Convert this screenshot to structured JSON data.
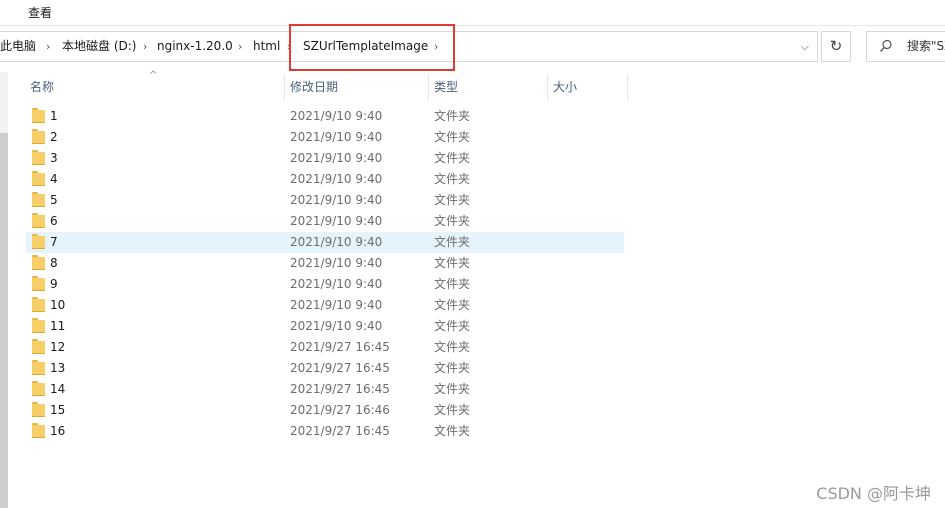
{
  "menubar": {
    "view_label": "查看"
  },
  "address_bar": {
    "crumbs": [
      "此电脑",
      "本地磁盘 (D:)",
      "nginx-1.20.0",
      "html",
      "SZUrlTemplateImage"
    ]
  },
  "search": {
    "placeholder": "搜索\"SZ"
  },
  "columns": {
    "name": "名称",
    "date": "修改日期",
    "type": "类型",
    "size": "大小"
  },
  "files": [
    {
      "name": "1",
      "date": "2021/9/10 9:40",
      "type": "文件夹"
    },
    {
      "name": "2",
      "date": "2021/9/10 9:40",
      "type": "文件夹"
    },
    {
      "name": "3",
      "date": "2021/9/10 9:40",
      "type": "文件夹"
    },
    {
      "name": "4",
      "date": "2021/9/10 9:40",
      "type": "文件夹"
    },
    {
      "name": "5",
      "date": "2021/9/10 9:40",
      "type": "文件夹"
    },
    {
      "name": "6",
      "date": "2021/9/10 9:40",
      "type": "文件夹"
    },
    {
      "name": "7",
      "date": "2021/9/10 9:40",
      "type": "文件夹"
    },
    {
      "name": "8",
      "date": "2021/9/10 9:40",
      "type": "文件夹"
    },
    {
      "name": "9",
      "date": "2021/9/10 9:40",
      "type": "文件夹"
    },
    {
      "name": "10",
      "date": "2021/9/10 9:40",
      "type": "文件夹"
    },
    {
      "name": "11",
      "date": "2021/9/10 9:40",
      "type": "文件夹"
    },
    {
      "name": "12",
      "date": "2021/9/27 16:45",
      "type": "文件夹"
    },
    {
      "name": "13",
      "date": "2021/9/27 16:45",
      "type": "文件夹"
    },
    {
      "name": "14",
      "date": "2021/9/27 16:45",
      "type": "文件夹"
    },
    {
      "name": "15",
      "date": "2021/9/27 16:46",
      "type": "文件夹"
    },
    {
      "name": "16",
      "date": "2021/9/27 16:45",
      "type": "文件夹"
    }
  ],
  "watermark": "CSDN @阿卡坤",
  "colors": {
    "highlight": "#e53935",
    "selected_row": "#e5f3fb",
    "folder": "#f6cf68"
  }
}
